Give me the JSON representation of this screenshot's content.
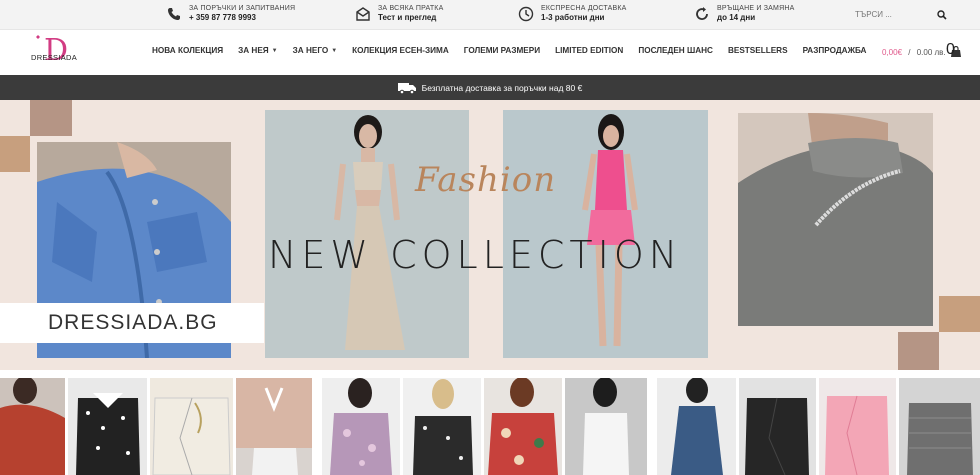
{
  "topbar": {
    "orders": {
      "label": "ЗА ПОРЪЧКИ И ЗАПИТВАНИЯ",
      "value": "+ 359 87 778 9993",
      "icon": "phone-icon"
    },
    "shipment": {
      "label": "ЗА ВСЯКА ПРАТКА",
      "value": "Тест и преглед",
      "icon": "envelope-icon"
    },
    "delivery": {
      "label": "ЕКСПРЕСНА ДОСТАВКА",
      "value": "1-3 работни дни",
      "icon": "clock-icon"
    },
    "returns": {
      "label": "ВРЪЩАНЕ И ЗАМЯНА",
      "value": "до 14 дни",
      "icon": "return-icon"
    },
    "search_placeholder": "ТЪРСИ ..."
  },
  "logo": {
    "letter": "D",
    "name": "DRESSIADA"
  },
  "menu": [
    {
      "label": "НОВА КОЛЕКЦИЯ",
      "caret": false
    },
    {
      "label": "ЗА НЕЯ",
      "caret": true
    },
    {
      "label": "ЗА НЕГО",
      "caret": true
    },
    {
      "label": "КОЛЕКЦИЯ ЕСЕН-ЗИМА",
      "caret": false
    },
    {
      "label": "ГОЛЕМИ РАЗМЕРИ",
      "caret": false
    },
    {
      "label": "LIMITED EDITION",
      "caret": false
    },
    {
      "label": "ПОСЛЕДЕН ШАНС",
      "caret": false
    },
    {
      "label": "BESTSELLERS",
      "caret": false
    },
    {
      "label": "РАЗПРОДАЖБА",
      "caret": false
    }
  ],
  "cart": {
    "price": "0,00€",
    "separator": " / ",
    "price_alt": "0.00 лв.",
    "count": "0"
  },
  "shipping_banner": "Безплатна доставка за поръчки над 80 €",
  "hero": {
    "fashion": "Fashion",
    "headline": "NEW COLLECTION",
    "brand": "DRESSIADA.BG"
  },
  "colors": {
    "accent": "#e05a8c",
    "hero_bg": "#f1e5de",
    "banner_bg": "#3b3b3b",
    "gold": "#b9855c"
  }
}
